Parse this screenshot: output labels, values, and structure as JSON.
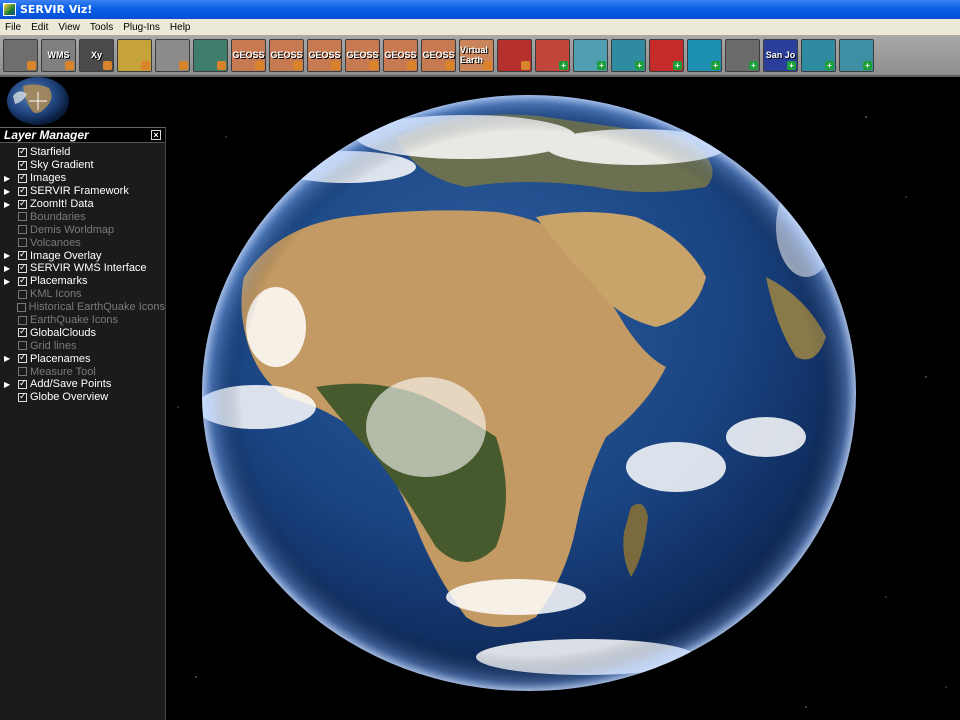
{
  "window": {
    "title": "SERVIR Viz!"
  },
  "menu": [
    "File",
    "Edit",
    "View",
    "Tools",
    "Plug-Ins",
    "Help"
  ],
  "toolbar": [
    {
      "id": "layers",
      "label": "",
      "bg": "#6e6e6e",
      "badge": "dot"
    },
    {
      "id": "wms",
      "label": "WMS",
      "bg": "#808080",
      "badge": "dot"
    },
    {
      "id": "xy",
      "label": "Xy",
      "bg": "#4a4a4a",
      "badge": "dot"
    },
    {
      "id": "gradient",
      "label": "",
      "bg": "#c6a23a",
      "badge": "dot"
    },
    {
      "id": "measure",
      "label": "",
      "bg": "#8b8b8b",
      "badge": "dot"
    },
    {
      "id": "chart",
      "label": "",
      "bg": "#3e7d6b",
      "badge": "dot"
    },
    {
      "id": "geoss1",
      "label": "GEOSS",
      "bg": "#c77a52",
      "badge": "dot"
    },
    {
      "id": "geoss2",
      "label": "GEOSS",
      "bg": "#c77a52",
      "badge": "dot"
    },
    {
      "id": "geoss3",
      "label": "GEOSS",
      "bg": "#c77a52",
      "badge": "dot"
    },
    {
      "id": "geoss4",
      "label": "GEOSS",
      "bg": "#c77a52",
      "badge": "dot"
    },
    {
      "id": "geoss5",
      "label": "GEOSS",
      "bg": "#c77a52",
      "badge": "dot"
    },
    {
      "id": "geoss6",
      "label": "GEOSS",
      "bg": "#c77a52",
      "badge": "dot"
    },
    {
      "id": "virtualearth",
      "label": "Virtual Earth",
      "bg": "#c9845a",
      "badge": "dot"
    },
    {
      "id": "radar",
      "label": "",
      "bg": "#b5302d",
      "badge": "dot"
    },
    {
      "id": "fire",
      "label": "",
      "bg": "#c0453a",
      "badge": "plus"
    },
    {
      "id": "border",
      "label": "",
      "bg": "#4f9fb0",
      "badge": "plus"
    },
    {
      "id": "map1",
      "label": "",
      "bg": "#2f8ba0",
      "badge": "plus"
    },
    {
      "id": "hazard",
      "label": "",
      "bg": "#c52b2b",
      "badge": "plus"
    },
    {
      "id": "water",
      "label": "",
      "bg": "#1d8fb2",
      "badge": "plus"
    },
    {
      "id": "mountain",
      "label": "",
      "bg": "#6b6b6b",
      "badge": "plus"
    },
    {
      "id": "sanjose",
      "label": "San Jo",
      "bg": "#2b3f9a",
      "badge": "plus"
    },
    {
      "id": "map2",
      "label": "",
      "bg": "#2f8ba0",
      "badge": "plus"
    },
    {
      "id": "elevation",
      "label": "",
      "bg": "#3e8fa3",
      "badge": "plus"
    }
  ],
  "layer_manager": {
    "title": "Layer Manager",
    "items": [
      {
        "label": "Starfield",
        "checked": true,
        "enabled": true,
        "expandable": false
      },
      {
        "label": "Sky Gradient",
        "checked": true,
        "enabled": true,
        "expandable": false
      },
      {
        "label": "Images",
        "checked": true,
        "enabled": true,
        "expandable": true
      },
      {
        "label": "SERVIR Framework",
        "checked": true,
        "enabled": true,
        "expandable": true
      },
      {
        "label": "ZoomIt! Data",
        "checked": true,
        "enabled": true,
        "expandable": true
      },
      {
        "label": "Boundaries",
        "checked": false,
        "enabled": false,
        "expandable": false
      },
      {
        "label": "Demis Worldmap",
        "checked": false,
        "enabled": false,
        "expandable": false
      },
      {
        "label": "Volcanoes",
        "checked": false,
        "enabled": false,
        "expandable": false
      },
      {
        "label": "Image Overlay",
        "checked": true,
        "enabled": true,
        "expandable": true
      },
      {
        "label": "SERVIR WMS Interface",
        "checked": true,
        "enabled": true,
        "expandable": true
      },
      {
        "label": "Placemarks",
        "checked": true,
        "enabled": true,
        "expandable": true
      },
      {
        "label": "KML Icons",
        "checked": false,
        "enabled": false,
        "expandable": false
      },
      {
        "label": "Historical EarthQuake Icons",
        "checked": false,
        "enabled": false,
        "expandable": false
      },
      {
        "label": "EarthQuake Icons",
        "checked": false,
        "enabled": false,
        "expandable": false
      },
      {
        "label": "GlobalClouds",
        "checked": true,
        "enabled": true,
        "expandable": false
      },
      {
        "label": "Grid lines",
        "checked": false,
        "enabled": false,
        "expandable": false
      },
      {
        "label": "Placenames",
        "checked": true,
        "enabled": true,
        "expandable": true
      },
      {
        "label": "Measure Tool",
        "checked": false,
        "enabled": false,
        "expandable": false
      },
      {
        "label": "Add/Save Points",
        "checked": true,
        "enabled": true,
        "expandable": true
      },
      {
        "label": "Globe Overview",
        "checked": true,
        "enabled": true,
        "expandable": false
      }
    ]
  },
  "colors": {
    "titlebar": "#0a5fe6",
    "menubar": "#ece9d8",
    "ocean": "#123e7a",
    "land_desert": "#c7a06a",
    "land_green": "#3f5a2a"
  }
}
